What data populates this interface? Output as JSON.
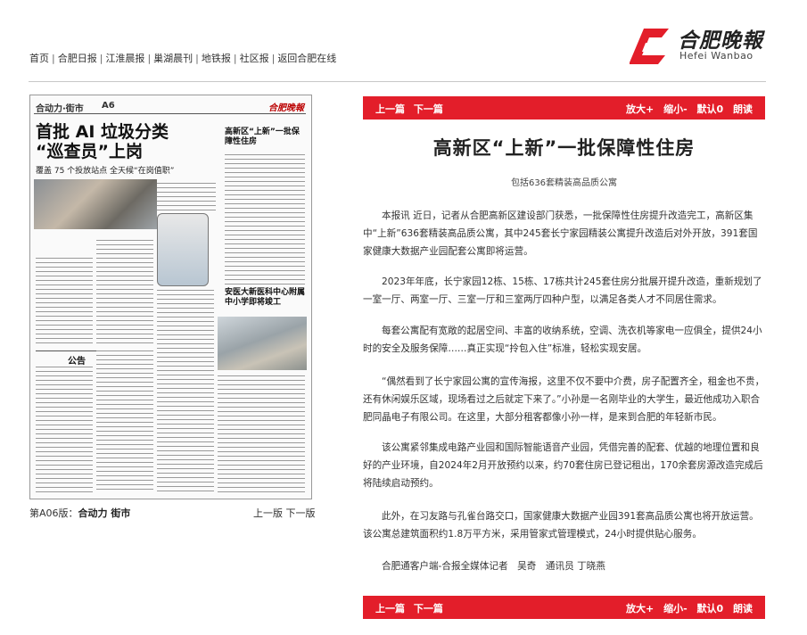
{
  "nav": {
    "items": [
      "首页",
      "合肥日报",
      "江淮晨报",
      "巢湖晨刊",
      "地铁报",
      "社区报",
      "返回合肥在线"
    ]
  },
  "logo": {
    "cn": "合肥晚報",
    "en": "Hefei Wanbao"
  },
  "newspaper": {
    "section": "合动力·街市",
    "page": "A6",
    "brand": "合肥晚報",
    "headline1": "首批 AI 垃圾分类",
    "headline2": "“巡查员”上岗",
    "deck": "覆盖 75 个投放站点   全天候“在岗值职”",
    "right_head1": "高新区“上新”一批保障性住房",
    "right_head2": "安医大新医科中心附属中小学即将竣工",
    "notice": "公告"
  },
  "paper_caption": {
    "prefix": "第A06版：",
    "name": "合动力 街市"
  },
  "paper_nav": {
    "prev": "上一版",
    "next": "下一版"
  },
  "toolbar": {
    "prev": "上一篇",
    "next": "下一篇",
    "zoom_in": "放大+",
    "zoom_out": "缩小-",
    "default": "默认0",
    "read": "朗读"
  },
  "article": {
    "title": "高新区“上新”一批保障性住房",
    "subtitle": "包括636套精装高品质公寓",
    "paragraphs": [
      "本报讯 近日，记者从合肥高新区建设部门获悉，一批保障性住房提升改造完工，高新区集中“上新”636套精装高品质公寓，其中245套长宁家园精装公寓提升改造后对外开放，391套国家健康大数据产业园配套公寓即将运营。",
      "2023年年底，长宁家园12栋、15栋、17栋共计245套住房分批展开提升改造，重新规划了一室一厅、两室一厅、三室一厅和三室两厅四种户型，以满足各类人才不同居住需求。",
      "每套公寓配有宽敞的起居空间、丰富的收纳系统，空调、洗衣机等家电一应俱全，提供24小时的安全及服务保障……真正实现“拎包入住”标准，轻松实现安居。",
      "“偶然看到了长宁家园公寓的宣传海报，这里不仅不要中介费，房子配置齐全，租金也不贵，还有休闲娱乐区域，现场看过之后就定下来了。”小孙是一名刚毕业的大学生，最近他成功入职合肥同晶电子有限公司。在这里，大部分租客都像小孙一样，是来到合肥的年轻新市民。",
      "该公寓紧邻集成电路产业园和国际智能语音产业园，凭借完善的配套、优越的地理位置和良好的产业环境，自2024年2月开放预约以来，约70套住房已登记租出，170余套房源改造完成后将陆续启动预约。",
      "此外，在习友路与孔雀台路交口，国家健康大数据产业园391套高品质公寓也将开放运营。该公寓总建筑面积约1.8万平方米，采用管家式管理模式，24小时提供贴心服务。"
    ],
    "byline": "合肥通客户端-合报全媒体记者　吴奇　通讯员 丁晓燕"
  }
}
